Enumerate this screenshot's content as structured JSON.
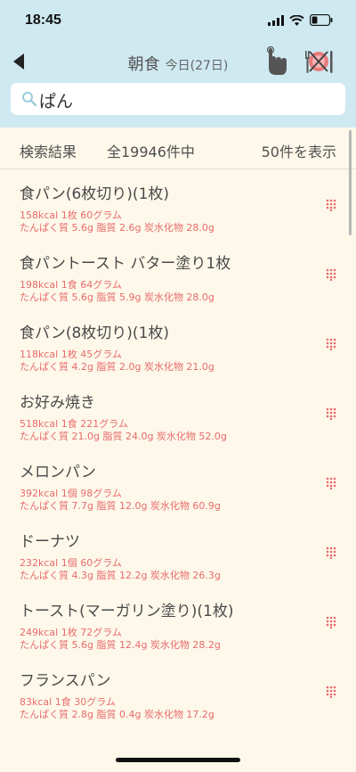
{
  "status": {
    "time": "18:45"
  },
  "nav": {
    "meal": "朝食",
    "date": "今日(27日)"
  },
  "search": {
    "value": "ぱん"
  },
  "results": {
    "label": "検索結果",
    "total": "全19946件中",
    "shown": "50件を表示"
  },
  "items": [
    {
      "name": "食パン(6枚切り)(1枚)",
      "line1": "158kcal  1枚  60グラム",
      "line2": "たんぱく質 5.6g  脂質 2.6g  炭水化物 28.0g"
    },
    {
      "name": "食パントースト バター塗り1枚",
      "line1": "198kcal  1食  64グラム",
      "line2": "たんぱく質 5.6g  脂質 5.9g  炭水化物 28.0g"
    },
    {
      "name": "食パン(8枚切り)(1枚)",
      "line1": "118kcal  1枚  45グラム",
      "line2": "たんぱく質 4.2g  脂質 2.0g  炭水化物 21.0g"
    },
    {
      "name": "お好み焼き",
      "line1": "518kcal  1食  221グラム",
      "line2": "たんぱく質 21.0g  脂質 24.0g  炭水化物 52.0g"
    },
    {
      "name": "メロンパン",
      "line1": "392kcal  1個  98グラム",
      "line2": "たんぱく質 7.7g  脂質 12.0g  炭水化物 60.9g"
    },
    {
      "name": "ドーナツ",
      "line1": "232kcal  1個  60グラム",
      "line2": "たんぱく質 4.3g  脂質 12.2g  炭水化物 26.3g"
    },
    {
      "name": "トースト(マーガリン塗り)(1枚)",
      "line1": "249kcal  1枚  72グラム",
      "line2": "たんぱく質 5.6g  脂質 12.4g  炭水化物 28.2g"
    },
    {
      "name": "フランスパン",
      "line1": "83kcal  1食  30グラム",
      "line2": "たんぱく質 2.8g  脂質 0.4g  炭水化物 17.2g"
    }
  ],
  "colors": {
    "header": "#cfe9f1",
    "background": "#fdf8ea",
    "accent": "#e86b6b",
    "text": "#4a4a4a"
  },
  "icons": {
    "back": "back-arrow-icon",
    "tap": "hand-tap-icon",
    "meal": "no-meal-icon",
    "search": "search-icon",
    "drag": "grip-dots-icon"
  }
}
